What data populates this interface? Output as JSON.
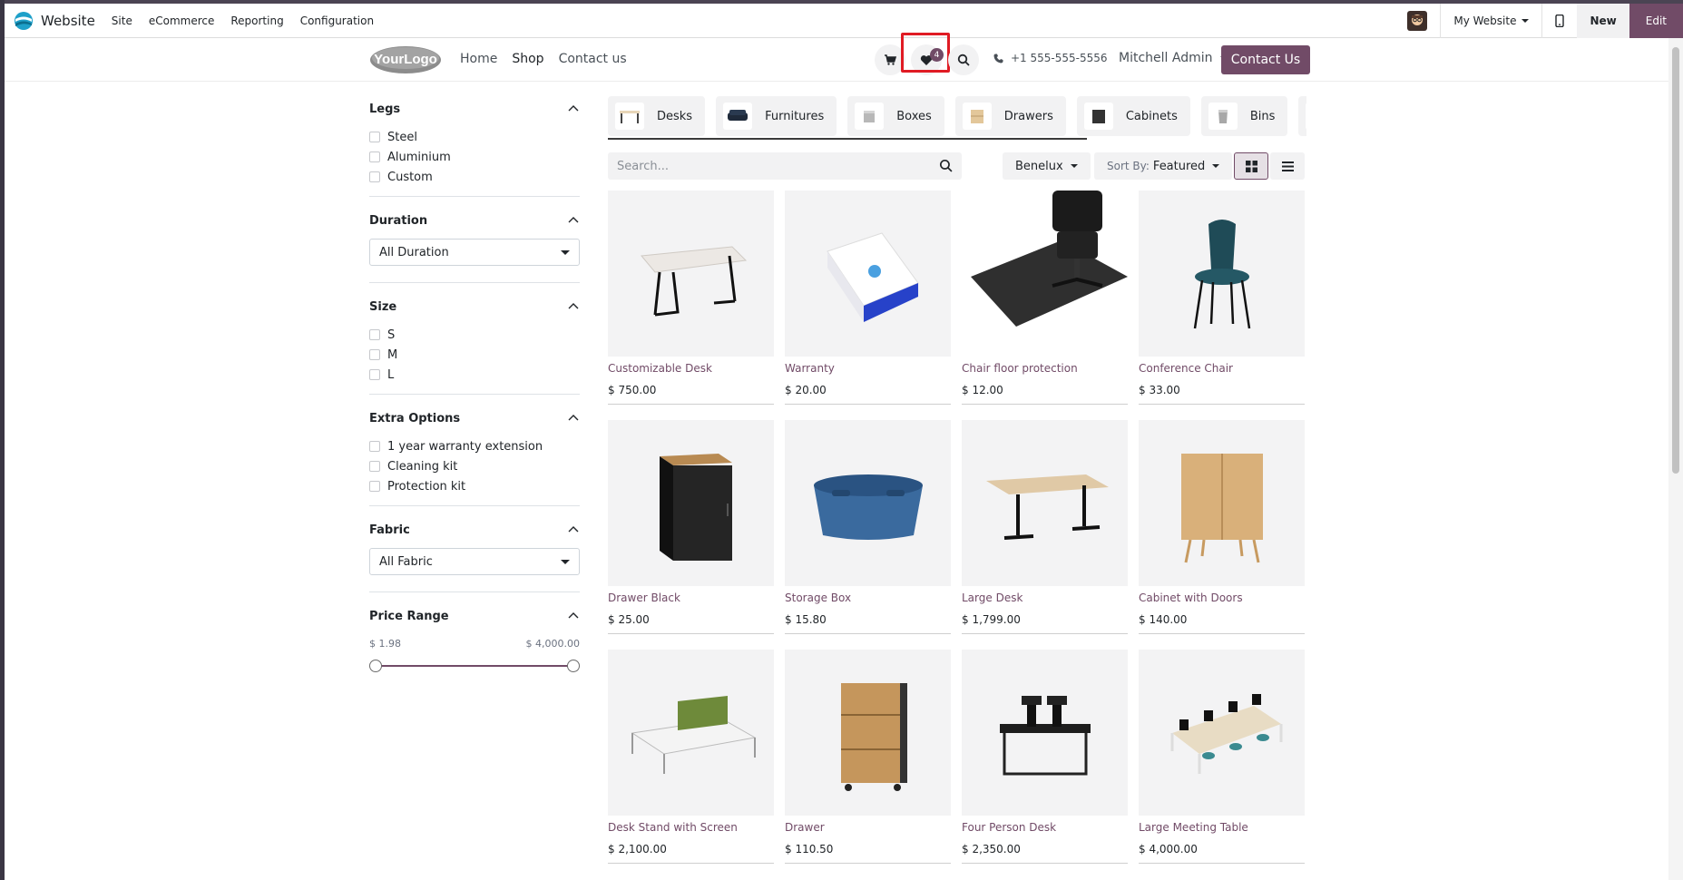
{
  "topbar": {
    "app_name": "Website",
    "menu": [
      "Site",
      "eCommerce",
      "Reporting",
      "Configuration"
    ],
    "website_switcher": "My Website",
    "new_label": "New",
    "edit_label": "Edit"
  },
  "header": {
    "logo_text": "YourLogo",
    "nav": [
      "Home",
      "Shop",
      "Contact us"
    ],
    "wishlist_count": "4",
    "phone": "+1 555-555-5556",
    "user": "Mitchell Admin",
    "contact_button": "Contact Us"
  },
  "filters": {
    "legs": {
      "title": "Legs",
      "options": [
        "Steel",
        "Aluminium",
        "Custom"
      ]
    },
    "duration": {
      "title": "Duration",
      "selected": "All Duration"
    },
    "size": {
      "title": "Size",
      "options": [
        "S",
        "M",
        "L"
      ]
    },
    "extra": {
      "title": "Extra Options",
      "options": [
        "1 year warranty extension",
        "Cleaning kit",
        "Protection kit"
      ]
    },
    "fabric": {
      "title": "Fabric",
      "selected": "All Fabric"
    },
    "price": {
      "title": "Price Range",
      "min": "$ 1.98",
      "max": "$ 4,000.00"
    }
  },
  "categories": [
    "Desks",
    "Furnitures",
    "Boxes",
    "Drawers",
    "Cabinets",
    "Bins"
  ],
  "toolbar": {
    "search_placeholder": "Search...",
    "pricelist": "Benelux",
    "sort_prefix": "Sort By:",
    "sort_value": "Featured"
  },
  "products": [
    {
      "name": "Customizable Desk",
      "price": "$ 750.00",
      "icon": "desk-image"
    },
    {
      "name": "Warranty",
      "price": "$ 20.00",
      "icon": "warranty-box-image"
    },
    {
      "name": "Chair floor protection",
      "price": "$ 12.00",
      "icon": "floor-mat-image"
    },
    {
      "name": "Conference Chair",
      "price": "$ 33.00",
      "icon": "chair-image"
    },
    {
      "name": "Drawer Black",
      "price": "$ 25.00",
      "icon": "drawer-black-image"
    },
    {
      "name": "Storage Box",
      "price": "$ 15.80",
      "icon": "storage-box-image"
    },
    {
      "name": "Large Desk",
      "price": "$ 1,799.00",
      "icon": "large-desk-image"
    },
    {
      "name": "Cabinet with Doors",
      "price": "$ 140.00",
      "icon": "cabinet-image"
    },
    {
      "name": "Desk Stand with Screen",
      "price": "$ 2,100.00",
      "icon": "desk-stand-image"
    },
    {
      "name": "Drawer",
      "price": "$ 110.50",
      "icon": "drawer-image"
    },
    {
      "name": "Four Person Desk",
      "price": "$ 2,350.00",
      "icon": "four-person-desk-image"
    },
    {
      "name": "Large Meeting Table",
      "price": "$ 4,000.00",
      "icon": "meeting-table-image"
    }
  ]
}
